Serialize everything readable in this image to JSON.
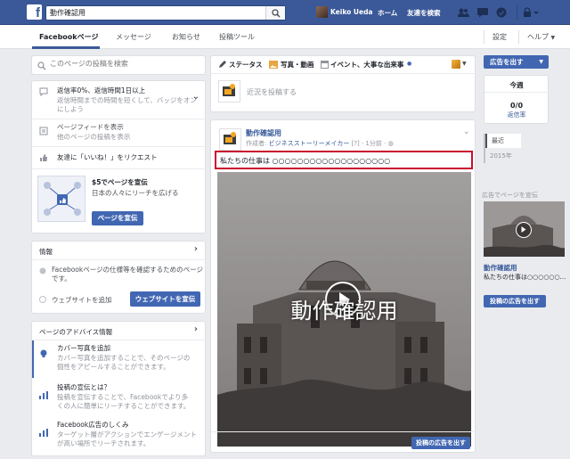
{
  "topbar": {
    "logo": "f",
    "search_value": "動作確認用",
    "user_name": "Keiko Ueda",
    "home": "ホーム",
    "find_friends": "友達を検索"
  },
  "subnav": {
    "tabs": [
      {
        "label": "Facebookページ"
      },
      {
        "label": "メッセージ"
      },
      {
        "label": "お知らせ"
      },
      {
        "label": "投稿ツール"
      }
    ],
    "settings": "設定",
    "help": "ヘルプ"
  },
  "left": {
    "search_placeholder": "このページの投稿を検索",
    "response": {
      "line1": "返信率0%、返信時間1日以上",
      "line2": "返信時間までの時間を短くして、バッジをオン",
      "line3": "にしよう"
    },
    "feed": {
      "title": "ページフィードを表示",
      "sub": "他のページの投稿を表示"
    },
    "invite": "友達に「いいね！」をリクエスト",
    "promo": {
      "title": "$5でページを宣伝",
      "sub": "日本の人々にリーチを広げる",
      "button": "ページを宣伝"
    },
    "info": {
      "header": "情報",
      "text1": "Facebookページの仕様等を確認するためのページ",
      "text2": "です。",
      "website": "ウェブサイトを追加",
      "website_btn": "ウェブサイトを宣伝"
    },
    "advice": {
      "header": "ページのアドバイス情報",
      "items": [
        {
          "title": "カバー写真を追加",
          "l1": "カバー写真を追加することで、そのページの",
          "l2": "個性をアピールすることができます。"
        },
        {
          "title": "投稿の宣伝とは？",
          "l1": "投稿を宣伝することで、Facebookでより多",
          "l2": "くの人に簡単にリーチすることができます。"
        },
        {
          "title": "Facebook広告のしくみ",
          "l1": "ターゲット層がアクションでエンゲージメント",
          "l2": "が高い場所でリーチされます。"
        }
      ]
    }
  },
  "composer": {
    "status": "ステータス",
    "photo": "写真・動画",
    "event": "イベント、大事な出来事",
    "placeholder": "近況を投稿する"
  },
  "post": {
    "author": "動作確認用",
    "meta_prefix": "作成者: ",
    "meta_author": "ビジネスストーリーメイカー",
    "meta_suffix": " [?] · 1分前 · ",
    "text": "私たちの仕事は ○○○○○○○○○○○○○○○○○○○",
    "video_title": "動作確認用",
    "boost": "投稿の広告を出す"
  },
  "right": {
    "ad_button": "広告を出す",
    "this_week": "今週",
    "reach_value": "0/0",
    "reach_label": "返信率",
    "timeline": [
      "最近",
      "2015年"
    ],
    "promote_header": "広告でページを宣伝",
    "ad_title": "動作確認用",
    "ad_text": "私たちの仕事は○○○○○○...",
    "ad_boost": "投稿の広告を出す"
  },
  "colors": {
    "brand": "#3b5998",
    "button": "#4267b2",
    "highlight": "#c8102e"
  }
}
